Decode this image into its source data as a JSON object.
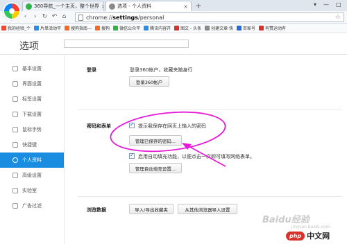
{
  "tabs": [
    {
      "title": "360导航_一个主页，整个世界",
      "active": false,
      "icon_color": "#2fb24a"
    },
    {
      "title": "选项 - 个人资料",
      "active": true,
      "icon_color": "#8a8a8a"
    }
  ],
  "new_tab_label": "+",
  "window_controls": {
    "down": "▾",
    "minimize": "—",
    "maximize": "□"
  },
  "toolbar": {
    "back": "‹",
    "forward": "›",
    "reload": "↻",
    "undo": "↶",
    "home": "⌂",
    "star": "☆"
  },
  "address_bar": {
    "scheme": "chrome://",
    "host": "settings",
    "path": "/personal"
  },
  "bookmarks": [
    {
      "label": "我的经验_个",
      "color": "#e94b35"
    },
    {
      "label": "片单活动平",
      "color": "#2a8de8"
    },
    {
      "label": "搜狗指南—",
      "color": "#ef6c2a"
    },
    {
      "label": "搜狗",
      "color": "#ef6c2a"
    },
    {
      "label": "微信公众平",
      "color": "#2fb24a"
    },
    {
      "label": "腾讯内容开",
      "color": "#2a8de8"
    },
    {
      "label": "图文 - 头条",
      "color": "#d8322c"
    },
    {
      "label": "创建文章·快",
      "color": "#8a8a8a"
    },
    {
      "label": "百家号",
      "color": "#2a6ad0"
    },
    {
      "label": "有赞运动有",
      "color": "#d8322c"
    }
  ],
  "page": {
    "title": "选项"
  },
  "sidebar": [
    {
      "label": "基本设置",
      "icon": "gear-icon",
      "active": false
    },
    {
      "label": "界面设置",
      "icon": "window-icon",
      "active": false
    },
    {
      "label": "标签设置",
      "icon": "tab-icon",
      "active": false
    },
    {
      "label": "下载设置",
      "icon": "download-icon",
      "active": false
    },
    {
      "label": "鼠标手势",
      "icon": "mouse-icon",
      "active": false
    },
    {
      "label": "快捷键",
      "icon": "keyboard-icon",
      "active": false
    },
    {
      "label": "个人资料",
      "icon": "user-icon",
      "active": true
    },
    {
      "label": "高级设置",
      "icon": "advanced-icon",
      "active": false
    },
    {
      "label": "实验室",
      "icon": "lab-icon",
      "active": false
    },
    {
      "label": "广告过滤",
      "icon": "block-icon",
      "active": false
    }
  ],
  "login": {
    "label": "登录",
    "description": "登录360帐户，收藏夹随身行",
    "button": "登录360帐户"
  },
  "passwords": {
    "label": "密码和表单",
    "save_passwords_checkbox": "提示我保存在网页上输入的密码",
    "save_passwords_checked": true,
    "manage_passwords_button": "管理已保存的密码...",
    "autofill_checkbox": "启用自动填充功能，以便点击一次即可填写网络表单。",
    "autofill_checked": true,
    "autofill_button": "管理自动填充设置..."
  },
  "browsing_data": {
    "label": "浏览数据",
    "import_export_button": "导入/导出收藏夹",
    "import_other_button": "从其他浏览器导入设置"
  },
  "annotation_color": "#e81ad8",
  "watermark": {
    "text": "Baidu经验",
    "subtext": "jingyan.baidu.com",
    "logo_badge": "php",
    "logo_text": "中文网"
  }
}
